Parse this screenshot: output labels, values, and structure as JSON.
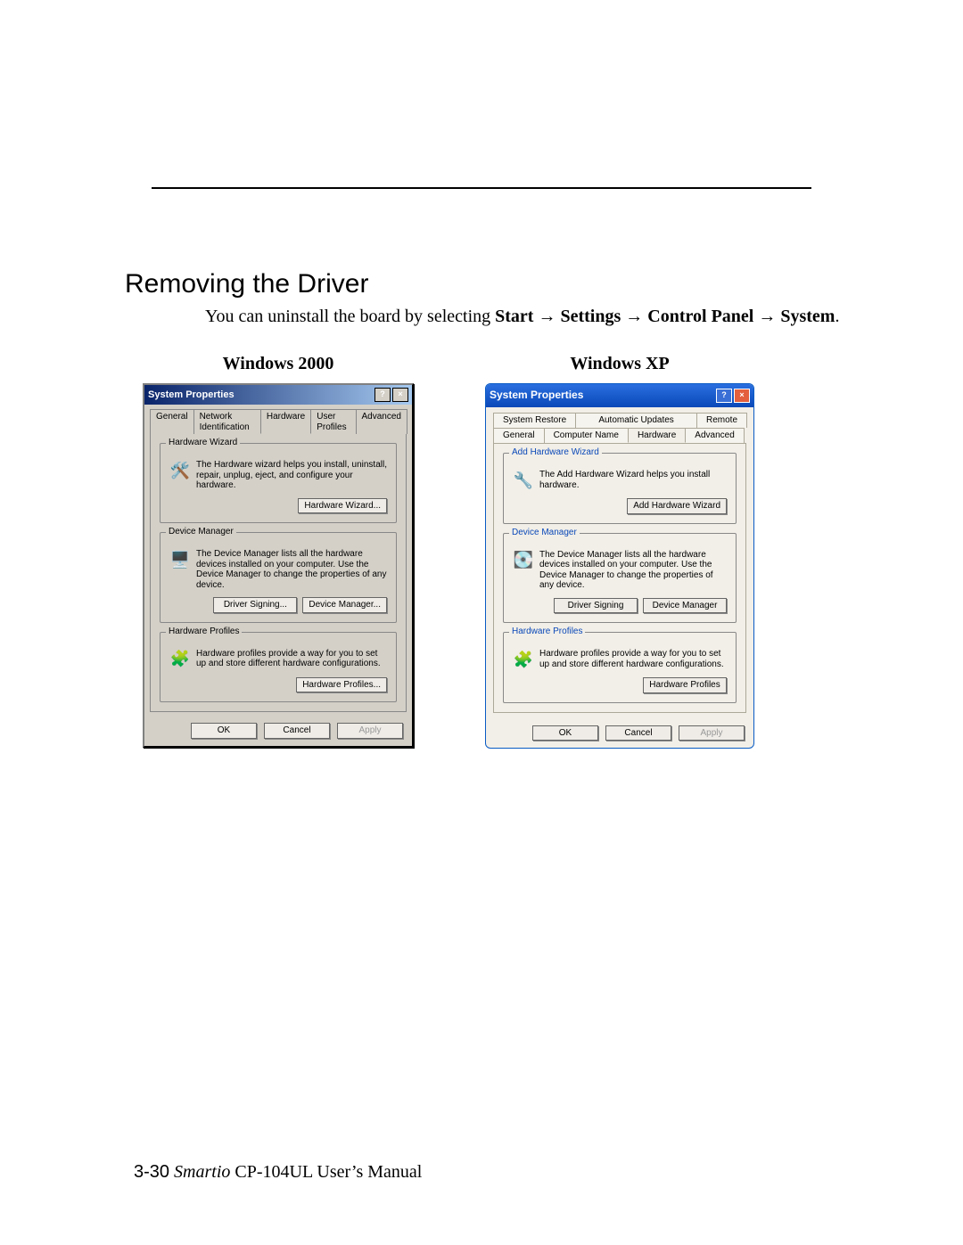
{
  "heading": "Removing the Driver",
  "intro": {
    "prefix": "You can uninstall the board by selecting ",
    "start": "Start",
    "settings": "Settings",
    "cpanel": "Control Panel",
    "system": "System",
    "arrow": " → ",
    "period": "."
  },
  "w2k": {
    "os_title": "Windows 2000",
    "title": "System Properties",
    "help": "?",
    "close": "×",
    "tabs": [
      "General",
      "Network Identification",
      "Hardware",
      "User Profiles",
      "Advanced"
    ],
    "hw": {
      "legend": "Hardware Wizard",
      "desc": "The Hardware wizard helps you install, uninstall, repair, unplug, eject, and configure your hardware.",
      "btn": "Hardware Wizard..."
    },
    "dm": {
      "legend": "Device Manager",
      "desc": "The Device Manager lists all the hardware devices installed on your computer. Use the Device Manager to change the properties of any device.",
      "btn1": "Driver Signing...",
      "btn2": "Device Manager..."
    },
    "hp": {
      "legend": "Hardware Profiles",
      "desc": "Hardware profiles provide a way for you to set up and store different hardware configurations.",
      "btn": "Hardware Profiles..."
    },
    "ok": "OK",
    "cancel": "Cancel",
    "apply": "Apply"
  },
  "xp": {
    "os_title": "Windows XP",
    "title": "System Properties",
    "help": "?",
    "close": "×",
    "tabs_row1": [
      "System Restore",
      "Automatic Updates",
      "Remote"
    ],
    "tabs_row2": [
      "General",
      "Computer Name",
      "Hardware",
      "Advanced"
    ],
    "hw": {
      "legend": "Add Hardware Wizard",
      "desc": "The Add Hardware Wizard helps you install hardware.",
      "btn": "Add Hardware Wizard"
    },
    "dm": {
      "legend": "Device Manager",
      "desc": "The Device Manager lists all the hardware devices installed on your computer. Use the Device Manager to change the properties of any device.",
      "btn1": "Driver Signing",
      "btn2": "Device Manager"
    },
    "hp": {
      "legend": "Hardware Profiles",
      "desc": "Hardware profiles provide a way for you to set up and store different hardware configurations.",
      "btn": "Hardware Profiles"
    },
    "ok": "OK",
    "cancel": "Cancel",
    "apply": "Apply"
  },
  "footer": {
    "page": "3-30",
    "brand": "Smartio",
    "rest": " CP-104UL User’s Manual"
  }
}
